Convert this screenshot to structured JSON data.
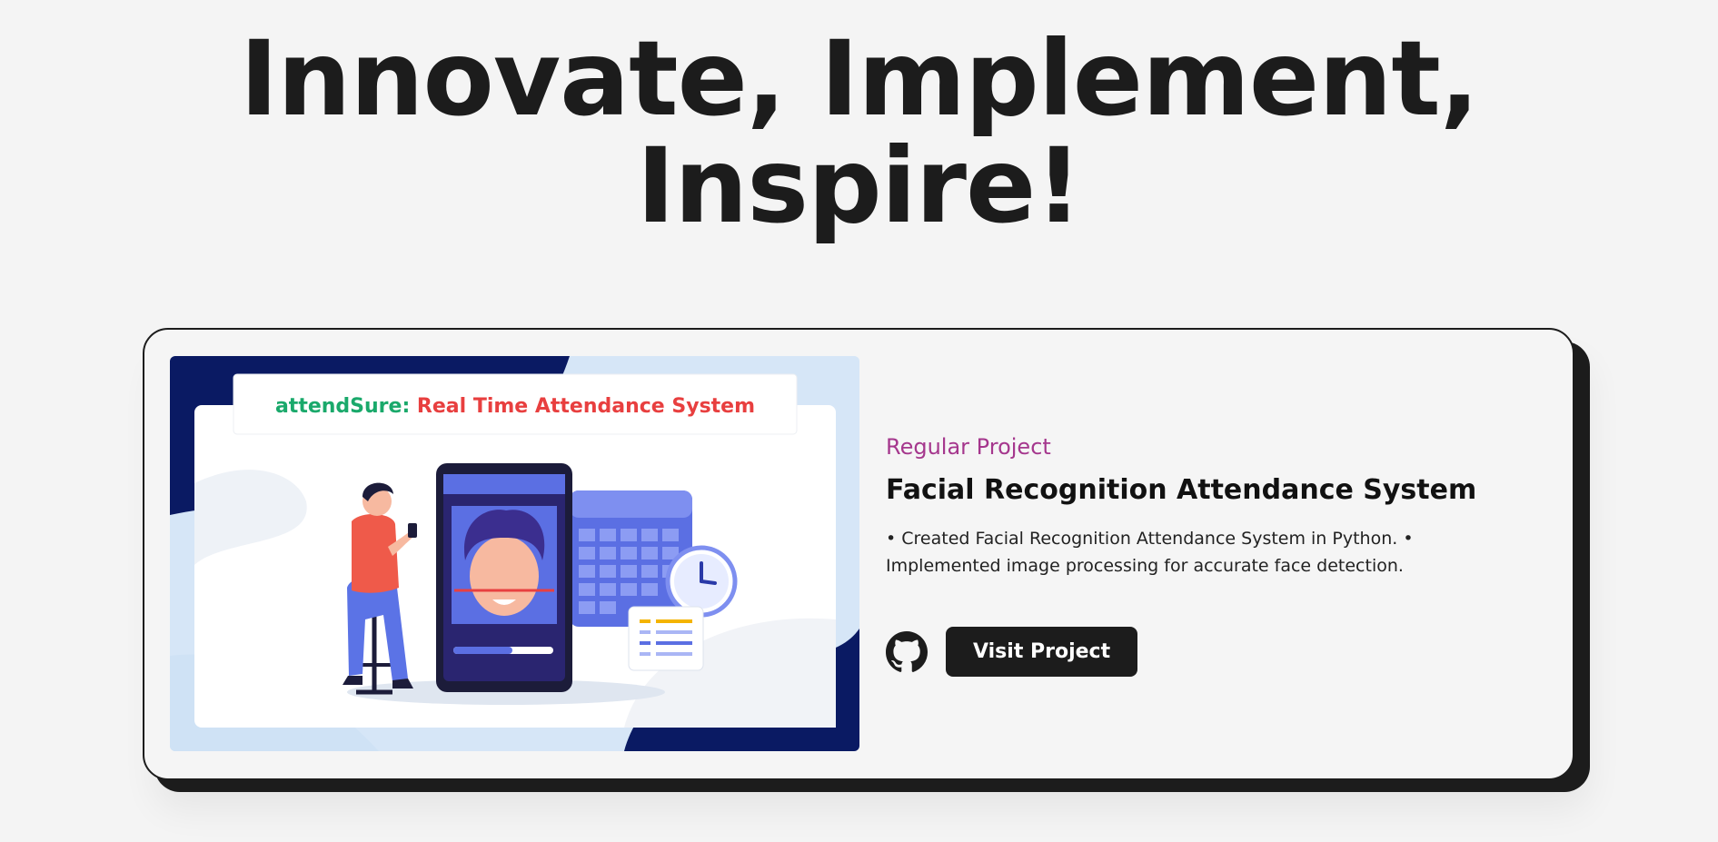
{
  "hero": {
    "line1": "Innovate, Implement,",
    "line2": "Inspire!"
  },
  "project": {
    "image": {
      "banner_prefix": "attendSure:",
      "banner_title": " Real Time Attendance System",
      "banner_prefix_color": "#1aa96b",
      "banner_title_color": "#e83f3f"
    },
    "tag": "Regular Project",
    "title": "Facial Recognition Attendance System",
    "description": "• Created Facial Recognition Attendance System in Python. • Implemented image processing for accurate face detection.",
    "github_icon": "github-icon",
    "visit_label": "Visit Project"
  },
  "colors": {
    "tag": "#a5378d",
    "dark": "#1c1c1c",
    "background": "#f4f4f4"
  }
}
